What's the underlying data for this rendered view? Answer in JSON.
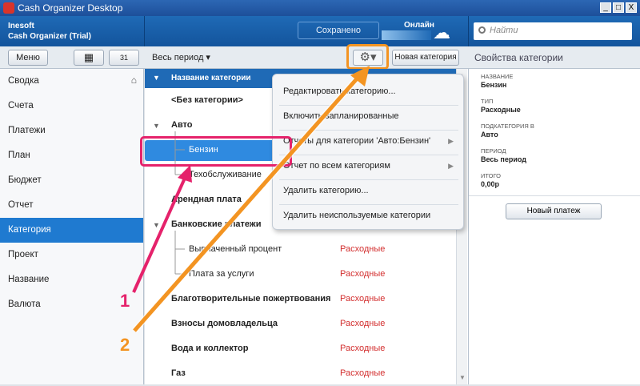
{
  "window": {
    "title": "Cash Organizer Desktop",
    "btn_min": "_",
    "btn_max": "□",
    "btn_close": "X"
  },
  "header": {
    "company": "Inesoft",
    "product": "Cash Organizer (Trial)",
    "saved": "Сохранено",
    "online": "Онлайн",
    "search_placeholder": "Найти"
  },
  "toolbar": {
    "menu": "Меню",
    "calc_icon": "▦",
    "cal_icon": "31",
    "period": "Весь период ▾",
    "gear": "⚙▾",
    "new_category": "Новая категория",
    "props_title": "Свойства категории"
  },
  "sidebar": {
    "items": [
      "Сводка",
      "Счета",
      "Платежи",
      "План",
      "Бюджет",
      "Отчет",
      "Категория",
      "Проект",
      "Название",
      "Валюта"
    ],
    "active": "Категория",
    "home_icon": "⌂"
  },
  "table": {
    "header": "Название категории",
    "rows": [
      {
        "name": "<Без категории>",
        "type": ""
      },
      {
        "name": "Авто",
        "type": ""
      },
      {
        "name": "Бензин",
        "type": ""
      },
      {
        "name": "Техобслуживание",
        "type": ""
      },
      {
        "name": "Арендная плата",
        "type": ""
      },
      {
        "name": "Банковские платежи",
        "type": ""
      },
      {
        "name": "Выплаченный процент",
        "type": "Расходные"
      },
      {
        "name": "Плата за услуги",
        "type": "Расходные"
      },
      {
        "name": "Благотворительные пожертвования",
        "type": "Расходные"
      },
      {
        "name": "Взносы домовладельца",
        "type": "Расходные"
      },
      {
        "name": "Вода и коллектор",
        "type": "Расходные"
      },
      {
        "name": "Газ",
        "type": "Расходные"
      }
    ]
  },
  "context_menu": {
    "items": [
      "Редактировать категорию...",
      "Включить запланированные",
      "Отчеты для категории 'Авто:Бензин'",
      "Отчет по всем категориям",
      "Удалить категорию...",
      "Удалить неиспользуемые категории"
    ]
  },
  "properties": {
    "name_label": "НАЗВАНИЕ",
    "name_value": "Бензин",
    "type_label": "ТИП",
    "type_value": "Расходные",
    "sub_label": "ПОДКАТЕГОРИЯ В",
    "sub_value": "Авто",
    "period_label": "ПЕРИОД",
    "period_value": "Весь период",
    "total_label": "ИТОГО",
    "total_value": "0,00р",
    "new_payment": "Новый платеж"
  },
  "annotations": {
    "label1": "1",
    "label2": "2"
  },
  "colors": {
    "accent": "#1f6ab6",
    "annotation1": "#e5226b",
    "annotation2": "#f39422",
    "expense": "#d32f2f"
  }
}
